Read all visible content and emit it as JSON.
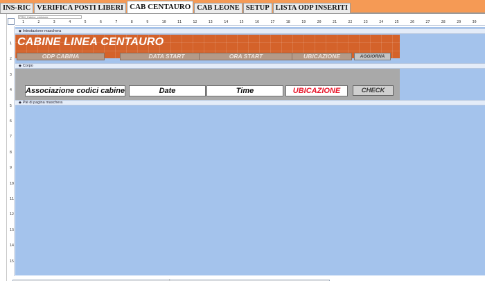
{
  "tabs": [
    {
      "label": "INS-RIC",
      "active": false
    },
    {
      "label": "VERIFICA POSTI LIBERI",
      "active": false
    },
    {
      "label": "CAB CENTAURO",
      "active": true
    },
    {
      "label": "CAB LEONE",
      "active": false
    },
    {
      "label": "SETUP",
      "active": false
    },
    {
      "label": "LISTA ODP INSERITI",
      "active": false
    }
  ],
  "form_name": "FRM_Cabine_centauro",
  "sections": {
    "header": "Intestazione maschera",
    "body": "Corpo",
    "footer": "Piè di pagina maschera"
  },
  "header": {
    "title": "CABINE LINEA CENTAURO",
    "labels": [
      "ODP CABINA",
      "DATA START",
      "ORA START",
      "UBICAZIONE"
    ],
    "refresh_button": "AGGIORNA"
  },
  "body": {
    "fields": [
      "Associazione codici cabine Que",
      "Date",
      "Time",
      "UBICAZIONE"
    ],
    "check_button": "CHECK"
  },
  "colors": {
    "header_band": "#d4622a",
    "canvas": "#a4c3ec",
    "ubicazione_text": "#e8162a",
    "app_background": "#f59a55"
  },
  "ruler_top": [
    "1",
    "2",
    "3",
    "4",
    "5",
    "6",
    "7",
    "8",
    "9",
    "10",
    "11",
    "12",
    "13",
    "14",
    "15",
    "16",
    "17",
    "18",
    "19",
    "20",
    "21",
    "22",
    "23",
    "24",
    "25",
    "26",
    "27",
    "28",
    "29",
    "30"
  ],
  "ruler_left": [
    "1",
    "2",
    "3",
    "4",
    "5",
    "6",
    "7",
    "8",
    "9",
    "10",
    "11",
    "12",
    "13",
    "14",
    "15"
  ]
}
